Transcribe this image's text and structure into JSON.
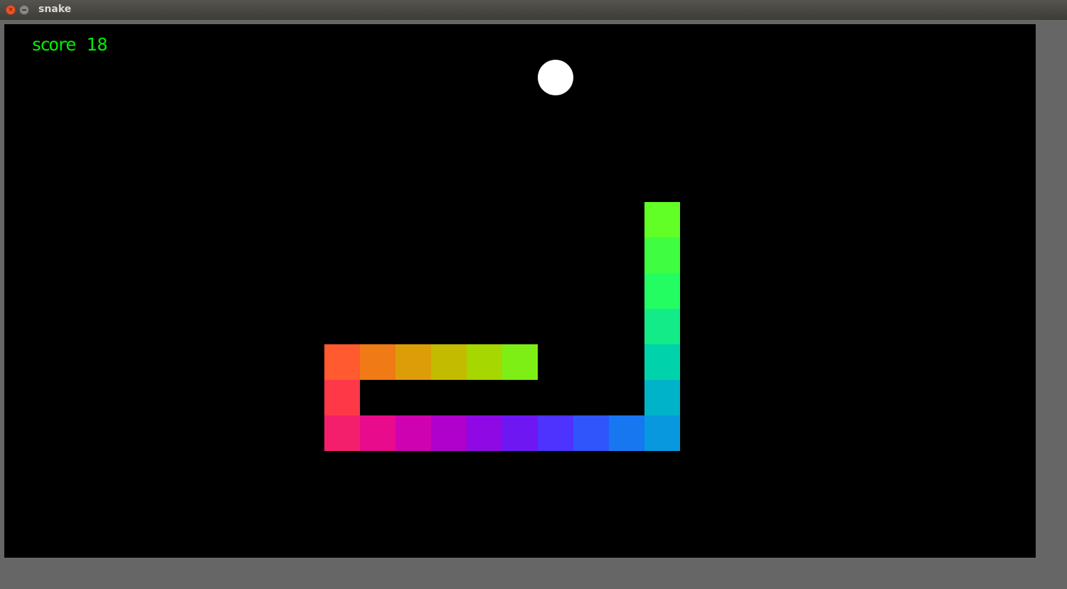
{
  "window": {
    "title": "snake"
  },
  "score": {
    "label": "score",
    "value": "18"
  },
  "grid": {
    "cols": 29,
    "rows": 15
  },
  "food": {
    "col": 15,
    "row": 1,
    "color": "#ffffff"
  },
  "snake": [
    {
      "col": 9,
      "row": 9,
      "color": "#FF5A30"
    },
    {
      "col": 10,
      "row": 9,
      "color": "#F07A15"
    },
    {
      "col": 11,
      "row": 9,
      "color": "#DD9D08"
    },
    {
      "col": 12,
      "row": 9,
      "color": "#C3BB00"
    },
    {
      "col": 13,
      "row": 9,
      "color": "#A6D700"
    },
    {
      "col": 14,
      "row": 9,
      "color": "#7DEF15"
    },
    {
      "col": 9,
      "row": 10,
      "color": "#FF3848"
    },
    {
      "col": 9,
      "row": 11,
      "color": "#F41F6C"
    },
    {
      "col": 10,
      "row": 11,
      "color": "#E80B8C"
    },
    {
      "col": 11,
      "row": 11,
      "color": "#CE02B0"
    },
    {
      "col": 12,
      "row": 11,
      "color": "#AF00CC"
    },
    {
      "col": 13,
      "row": 11,
      "color": "#8E09E3"
    },
    {
      "col": 14,
      "row": 11,
      "color": "#6E17F2"
    },
    {
      "col": 15,
      "row": 11,
      "color": "#4E32FE"
    },
    {
      "col": 16,
      "row": 11,
      "color": "#2F55FB"
    },
    {
      "col": 17,
      "row": 11,
      "color": "#1777F1"
    },
    {
      "col": 18,
      "row": 11,
      "color": "#0898DE"
    },
    {
      "col": 18,
      "row": 10,
      "color": "#00B3C8"
    },
    {
      "col": 18,
      "row": 9,
      "color": "#00D3AB"
    },
    {
      "col": 18,
      "row": 8,
      "color": "#12EB88"
    },
    {
      "col": 18,
      "row": 7,
      "color": "#23FD62"
    },
    {
      "col": 18,
      "row": 6,
      "color": "#3FFD40"
    },
    {
      "col": 18,
      "row": 5,
      "color": "#61FF25"
    }
  ]
}
